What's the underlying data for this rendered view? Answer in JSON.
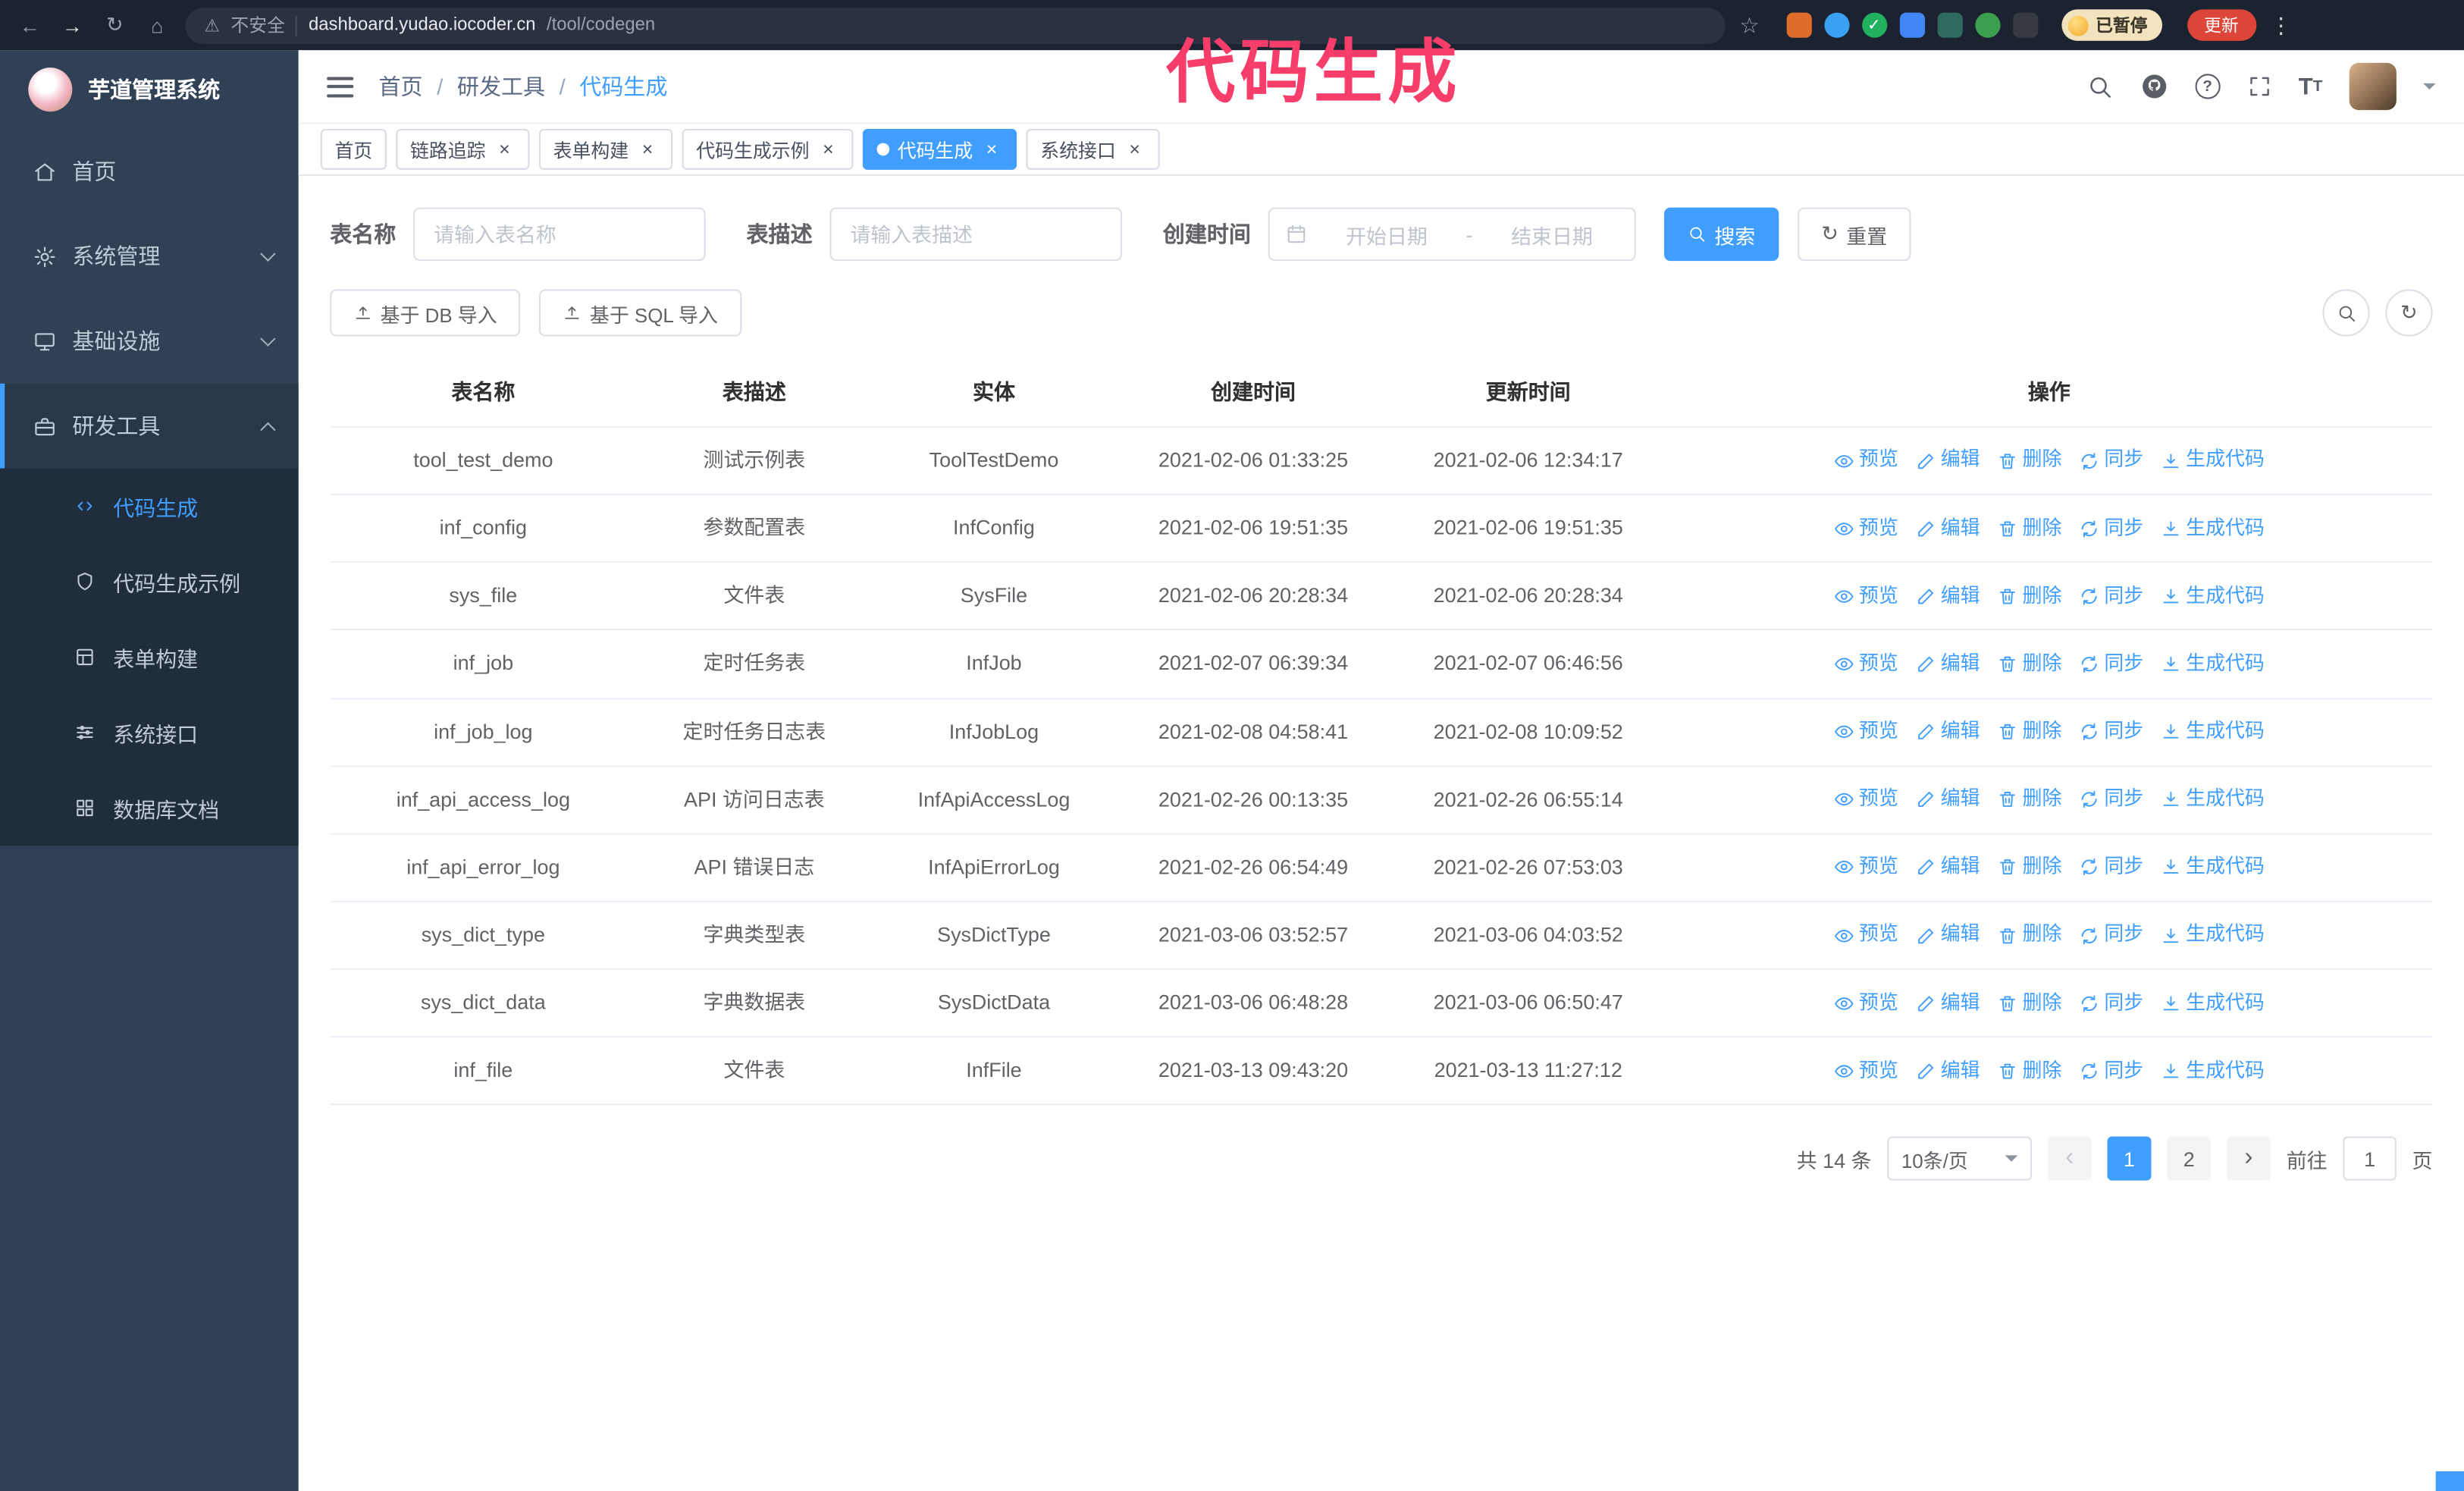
{
  "colors": {
    "primary": "#409EFF",
    "annotation": "#F73D6A",
    "sidebar_bg": "#304156",
    "submenu_bg": "#1F2D3D",
    "update_button_bg": "#DD4538",
    "paused_badge_bg": "#F2E3BE"
  },
  "annotation": "代码生成",
  "browser": {
    "security_label": "不安全",
    "url_host": "dashboard.yudao.iocoder.cn",
    "url_path": "/tool/codegen",
    "paused_badge": "已暂停",
    "update_button": "更新"
  },
  "icons": {
    "back": "←",
    "forward": "→",
    "reload": "↻",
    "home": "⌂",
    "warning": "⚠",
    "star": "☆",
    "kebab": "⋮",
    "close": "×",
    "refresh": "↻"
  },
  "sidebar": {
    "app_title": "芋道管理系统",
    "items": [
      {
        "label": "首页"
      },
      {
        "label": "系统管理"
      },
      {
        "label": "基础设施"
      },
      {
        "label": "研发工具"
      }
    ],
    "subitems": [
      {
        "label": "代码生成"
      },
      {
        "label": "代码生成示例"
      },
      {
        "label": "表单构建"
      },
      {
        "label": "系统接口"
      },
      {
        "label": "数据库文档"
      }
    ]
  },
  "breadcrumb": [
    "首页",
    "研发工具",
    "代码生成"
  ],
  "tabs": [
    "首页",
    "链路追踪",
    "表单构建",
    "代码生成示例",
    "代码生成",
    "系统接口"
  ],
  "filters": {
    "table_name_label": "表名称",
    "table_name_placeholder": "请输入表名称",
    "table_desc_label": "表描述",
    "table_desc_placeholder": "请输入表描述",
    "create_time_label": "创建时间",
    "date_start_placeholder": "开始日期",
    "date_separator": "-",
    "date_end_placeholder": "结束日期",
    "search_button": "搜索",
    "reset_button": "重置"
  },
  "toolbar": {
    "import_db": "基于 DB 导入",
    "import_sql": "基于 SQL 导入"
  },
  "table": {
    "columns": [
      "表名称",
      "表描述",
      "实体",
      "创建时间",
      "更新时间",
      "操作"
    ],
    "actions": [
      "预览",
      "编辑",
      "删除",
      "同步",
      "生成代码"
    ],
    "rows": [
      {
        "name": "tool_test_demo",
        "desc": "测试示例表",
        "entity": "ToolTestDemo",
        "created": "2021-02-06 01:33:25",
        "updated": "2021-02-06 12:34:17"
      },
      {
        "name": "inf_config",
        "desc": "参数配置表",
        "entity": "InfConfig",
        "created": "2021-02-06 19:51:35",
        "updated": "2021-02-06 19:51:35"
      },
      {
        "name": "sys_file",
        "desc": "文件表",
        "entity": "SysFile",
        "created": "2021-02-06 20:28:34",
        "updated": "2021-02-06 20:28:34"
      },
      {
        "name": "inf_job",
        "desc": "定时任务表",
        "entity": "InfJob",
        "created": "2021-02-07 06:39:34",
        "updated": "2021-02-07 06:46:56"
      },
      {
        "name": "inf_job_log",
        "desc": "定时任务日志表",
        "entity": "InfJobLog",
        "created": "2021-02-08 04:58:41",
        "updated": "2021-02-08 10:09:52"
      },
      {
        "name": "inf_api_access_log",
        "desc": "API 访问日志表",
        "entity": "InfApiAccessLog",
        "created": "2021-02-26 00:13:35",
        "updated": "2021-02-26 06:55:14"
      },
      {
        "name": "inf_api_error_log",
        "desc": "API 错误日志",
        "entity": "InfApiErrorLog",
        "created": "2021-02-26 06:54:49",
        "updated": "2021-02-26 07:53:03"
      },
      {
        "name": "sys_dict_type",
        "desc": "字典类型表",
        "entity": "SysDictType",
        "created": "2021-03-06 03:52:57",
        "updated": "2021-03-06 04:03:52"
      },
      {
        "name": "sys_dict_data",
        "desc": "字典数据表",
        "entity": "SysDictData",
        "created": "2021-03-06 06:48:28",
        "updated": "2021-03-06 06:50:47"
      },
      {
        "name": "inf_file",
        "desc": "文件表",
        "entity": "InfFile",
        "created": "2021-03-13 09:43:20",
        "updated": "2021-03-13 11:27:12"
      }
    ]
  },
  "pagination": {
    "total": "共 14 条",
    "page_size": "10条/页",
    "page1": "1",
    "page2": "2",
    "goto_label": "前往",
    "goto_value": "1",
    "goto_suffix": "页"
  }
}
